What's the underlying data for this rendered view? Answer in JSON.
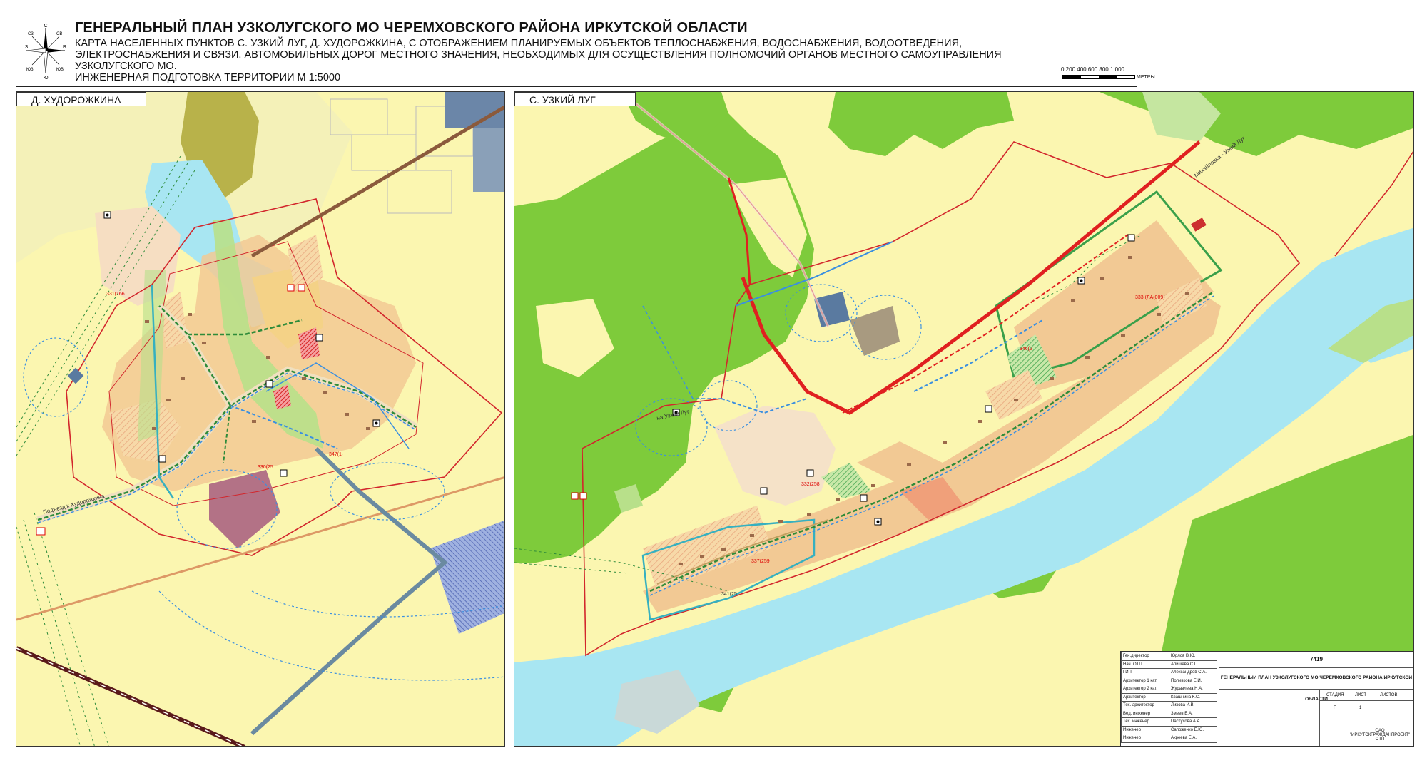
{
  "header": {
    "title": "ГЕНЕРАЛЬНЫЙ ПЛАН УЗКОЛУГСКОГО МО ЧЕРЕМХОВСКОГО РАЙОНА ИРКУТСКОЙ ОБЛАСТИ",
    "subtitle_lines": [
      "КАРТА НАСЕЛЕННЫХ ПУНКТОВ С. УЗКИЙ ЛУГ, Д. ХУДОРОЖКИНА, С ОТОБРАЖЕНИЕМ ПЛАНИРУЕМЫХ  ОБЪЕКТОВ ТЕПЛОСНАБЖЕНИЯ, ВОДОСНАБЖЕНИЯ, ВОДООТВЕДЕНИЯ,",
      "ЭЛЕКТРОСНАБЖЕНИЯ И СВЯЗИ. АВТОМОБИЛЬНЫХ ДОРОГ МЕСТНОГО ЗНАЧЕНИЯ, НЕОБХОДИМЫХ ДЛЯ ОСУЩЕСТВЛЕНИЯ ПОЛНОМОЧИЙ ОРГАНОВ МЕСТНОГО САМОУПРАВЛЕНИЯ",
      "УЗКОЛУГСКОГО МО.",
      "ИНЖЕНЕРНАЯ ПОДГОТОВКА ТЕРРИТОРИИ М 1:5000"
    ],
    "compass": {
      "north": "С",
      "south": "Ю",
      "west": "З",
      "east": "В",
      "nw": "СЗ",
      "ne": "СВ",
      "sw": "ЮЗ",
      "se": "ЮВ"
    },
    "scale": {
      "ticks": "0   200  400  600  800 1 000",
      "unit": "МЕТРЫ"
    }
  },
  "panels": {
    "left": {
      "label": "Д. ХУДОРОЖКИНА"
    },
    "right": {
      "label": "С. УЗКИЙ ЛУГ"
    }
  },
  "map_labels": {
    "road_left": "Подъезд к Худорожкина",
    "road_right": "на Узкий Луг",
    "highway": "Михайловка - Узкий Луг",
    "lot_331": "331(166",
    "lot_347": "347(1-",
    "lot_330": "330(25",
    "lot_333": "333 (ЛА(009)",
    "lot_332": "332(258",
    "lot_337": "337(259",
    "lot_341": "341(25",
    "lot_346": "346(2"
  },
  "colors": {
    "map_base": "#fbf6b0",
    "forest": "#7ecb3b",
    "river": "#a8e6f2",
    "settlement": "#f2c994",
    "boundary_red": "#d2262c",
    "pipe_blue": "#3a8fe0",
    "heating_green": "#2e8b3a",
    "main_road": "#e02020"
  },
  "stamp": {
    "rows": [
      [
        "Ген.директор",
        "Юрлов В.Ю."
      ],
      [
        "Нач. ОТП",
        "Апишева С.Г."
      ],
      [
        "ГИП",
        "Александров С.А."
      ],
      [
        "Архитектор 1 кат.",
        "Поливкова Е.И."
      ],
      [
        "Архитектор 2 кат.",
        "Журавлева Н.А."
      ],
      [
        "Архитектор",
        "Квашнина К.С."
      ],
      [
        "Тех. архитектор",
        "Лихова И.В."
      ],
      [
        "Вед. инженер",
        "Змеев Е.А."
      ],
      [
        "Тех. инженер",
        "Пастухова А.А."
      ],
      [
        "Инженер",
        "Сапоженко Е.Ю."
      ],
      [
        "Инженер",
        "Акреева Е.А."
      ]
    ],
    "code": "7419",
    "project_title": "ГЕНЕРАЛЬНЫЙ ПЛАН УЗКОЛУГСКОГО МО ЧЕРЕМХОВСКОГО РАЙОНА ИРКУТСКОЙ ОБЛАСТИ",
    "col_stage": "СТАДИЯ",
    "col_sheet": "ЛИСТ",
    "col_sheets": "ЛИСТОВ",
    "stage": "П",
    "sheet": "1",
    "company": "ОАО \"ИРКУТСКГРАЖДАНПРОЕКТ\" ОТП"
  }
}
